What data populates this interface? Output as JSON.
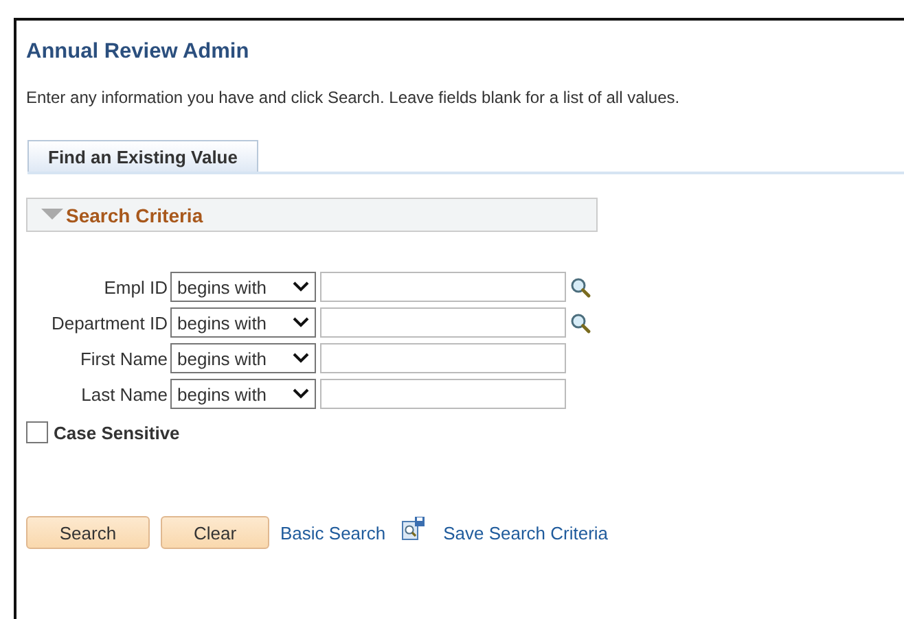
{
  "page": {
    "title": "Annual Review Admin",
    "instructions": "Enter any information you have and click Search. Leave fields blank for a list of all values."
  },
  "tabs": [
    {
      "label": "Find an Existing Value",
      "selected": true
    }
  ],
  "section": {
    "title": "Search Criteria",
    "expanded": true
  },
  "fields": [
    {
      "label": "Empl ID",
      "operator": "begins with",
      "lookup": true
    },
    {
      "label": "Department ID",
      "operator": "begins with",
      "lookup": true
    },
    {
      "label": "First Name",
      "operator": "begins with",
      "lookup": false
    },
    {
      "label": "Last Name",
      "operator": "begins with",
      "lookup": false
    }
  ],
  "case_sensitive": {
    "label": "Case Sensitive",
    "checked": false
  },
  "buttons": [
    "Search",
    "Clear"
  ],
  "links": [
    {
      "label": "Basic Search",
      "icon": false
    },
    {
      "label": "Save Search Criteria",
      "icon": true
    }
  ]
}
